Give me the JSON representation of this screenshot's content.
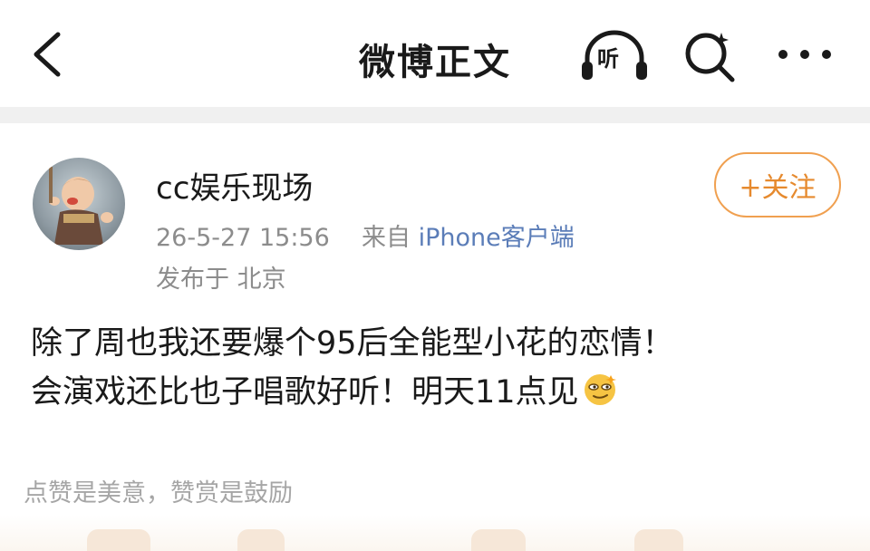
{
  "header": {
    "title": "微博正文",
    "back_icon": "chevron-left-icon",
    "listen_label": "听",
    "listen_icon": "headphones-icon",
    "search_icon": "search-icon",
    "more_icon": "more-dots-icon"
  },
  "post": {
    "author": "cc娱乐现场",
    "timestamp": "26-5-27 15:56",
    "source_prefix": "来自",
    "source_name": "iPhone客户端",
    "location": "发布于 北京",
    "follow_label": "+关注",
    "text_line1": "除了周也我还要爆个95后全能型小花的恋情！",
    "text_line2": "会演戏还比也子唱歌好听！明天11点见",
    "emoji": "smirk-emoji"
  },
  "footer": {
    "reward_note": "点赞是美意，赞赏是鼓励"
  },
  "colors": {
    "accent_orange": "#e68a2e",
    "link_blue": "#5b7db8",
    "meta_gray": "#8c8c8c"
  }
}
